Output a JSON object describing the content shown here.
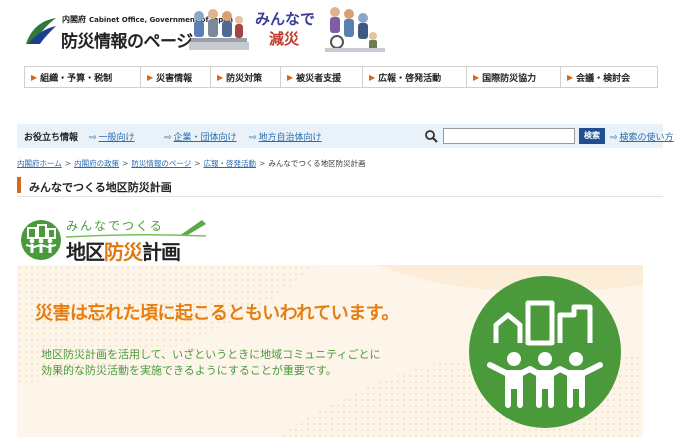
{
  "header": {
    "cabinet_ja": "内閣府",
    "cabinet_en": "Cabinet Office, Government of Japan",
    "site_title": "防災情報のページ",
    "banner_line1": "みんなで",
    "banner_line2": "減災"
  },
  "nav": {
    "items": [
      {
        "label": "組織・予算・税制"
      },
      {
        "label": "災害情報"
      },
      {
        "label": "防災対策"
      },
      {
        "label": "被災者支援"
      },
      {
        "label": "広報・啓発活動"
      },
      {
        "label": "国際防災協力"
      },
      {
        "label": "会議・検討会"
      }
    ]
  },
  "infobar": {
    "label": "お役立ち情報",
    "links": [
      {
        "label": "一般向け"
      },
      {
        "label": "企業・団体向け"
      },
      {
        "label": "地方自治体向け"
      }
    ],
    "search_placeholder": "",
    "search_button": "検索",
    "help_link": "検索の使い方"
  },
  "breadcrumb": {
    "items": [
      {
        "label": "内閣府ホーム"
      },
      {
        "label": "内閣府の政策"
      },
      {
        "label": "防災情報のページ"
      },
      {
        "label": "広報・啓発活動"
      }
    ],
    "current": "みんなでつくる地区防災計画",
    "separator": ">"
  },
  "page": {
    "title": "みんなでつくる地区防災計画"
  },
  "plan_logo": {
    "sub": "みんなでつくる",
    "main_prefix": "地区",
    "main_accent": "防災",
    "main_suffix": "計画"
  },
  "hero": {
    "heading": "災害は忘れた頃に起こるともいわれています。",
    "body_line1": "地区防災計画を活用して、いざというときに地域コミュニティごとに",
    "body_line2": "効果的な防災活動を実施できるようにすることが重要です。"
  },
  "colors": {
    "accent_orange": "#e67e12",
    "accent_green": "#4a9a3c",
    "link_blue": "#2b6cb0",
    "search_button": "#1f4f8f"
  }
}
